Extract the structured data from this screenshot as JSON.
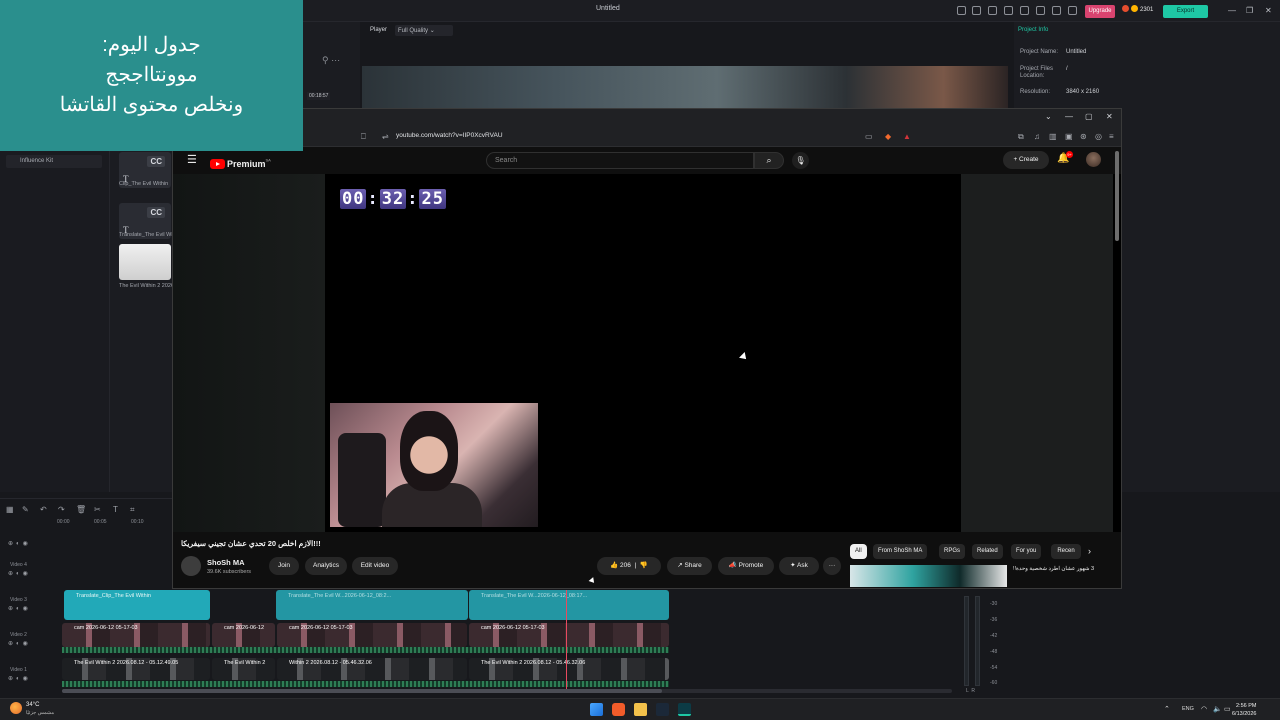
{
  "editor": {
    "title": "Untitled",
    "upgrade_label": "Upgrade",
    "credits": "2301",
    "export_label": "Export",
    "window_controls": [
      "—",
      "❐",
      "✕"
    ]
  },
  "schedule_note": {
    "line1": "جدول اليوم:",
    "line2": "موونتااججج",
    "line3": "ونخلص محتوى القاتشا"
  },
  "media": {
    "sidebar_item": "Influence Kit",
    "items": [
      {
        "caption": "Clip_The Evil Within",
        "badge": "CC",
        "glyph": "T"
      },
      {
        "caption": "Translate_The Evil Within",
        "badge": "CC",
        "glyph": "T"
      },
      {
        "caption": "The Evil Within 2 2026",
        "badge": "",
        "glyph": ""
      }
    ],
    "timecode": "00:18:57"
  },
  "player": {
    "label": "Player",
    "quality": "Full Quality"
  },
  "project_info": {
    "tab": "Project Info",
    "rows": [
      {
        "label": "Project Name:",
        "value": "Untitled"
      },
      {
        "label": "Project Files Location:",
        "value": "/"
      },
      {
        "label": "Resolution:",
        "value": "3840 x 2160"
      }
    ]
  },
  "browser": {
    "url": "youtube.com/watch?v=IIP0XcvRVAU",
    "window_controls": [
      "⌄",
      "—",
      "▢",
      "✕"
    ]
  },
  "youtube": {
    "logo_text": "Premium",
    "logo_sup": "SA",
    "search_placeholder": "Search",
    "create_label": "+ Create",
    "notif_count": "9+",
    "timer": {
      "h": "00",
      "m": "32",
      "s": "25"
    },
    "video_title": "!!!الازم اخلص 20 تحدي عشان تجيني سيفريكا",
    "channel_name": "ShoSh MA",
    "channel_subs": "39.6K subscribers",
    "join_label": "Join",
    "analytics_label": "Analytics",
    "edit_label": "Edit video",
    "likes": "206",
    "share_label": "Share",
    "promote_label": "Promote",
    "ask_label": "Ask",
    "more_label": "···",
    "chips": [
      "All",
      "From ShoSh MA",
      "RPGs",
      "Related",
      "For you",
      "Recen"
    ],
    "rec_title": "3 شهور عشان اطرد شخصية وحدة!!"
  },
  "timeline": {
    "ruler": [
      "00:00",
      "00:05",
      "00:10"
    ],
    "tracks": [
      "Video 4",
      "Video 3",
      "Video 2",
      "Video 1"
    ],
    "text_clips": [
      "Translate_Clip_The Evil Within",
      "Translate_The Evil W...2026-06-12_08:2...",
      "Translate_The Evil W...2026-06-12_08:17..."
    ],
    "cam_clips": [
      "cam 2026-06-12 05-17-03",
      "cam 2026-06-12",
      "cam 2026-06-12 05-17-03",
      "cam 2026-06-12 05-17-03"
    ],
    "game_clips": [
      "The Evil Within 2 2026.08.12 - 05.12.49.05",
      "The Evil Within 2",
      "Within 2 2026.08.12 - 05.46.32.06",
      "The Evil Within 2 2026.08.12 - 05.46.32.06"
    ],
    "db_labels": [
      "-30",
      "-36",
      "-42",
      "-48",
      "-54",
      "-60"
    ],
    "lr": "L  R"
  },
  "taskbar": {
    "temp": "34°C",
    "weather": "مشمس جزئيًا",
    "lang": "ENG",
    "time": "2:56 PM",
    "date": "6/13/2026"
  }
}
